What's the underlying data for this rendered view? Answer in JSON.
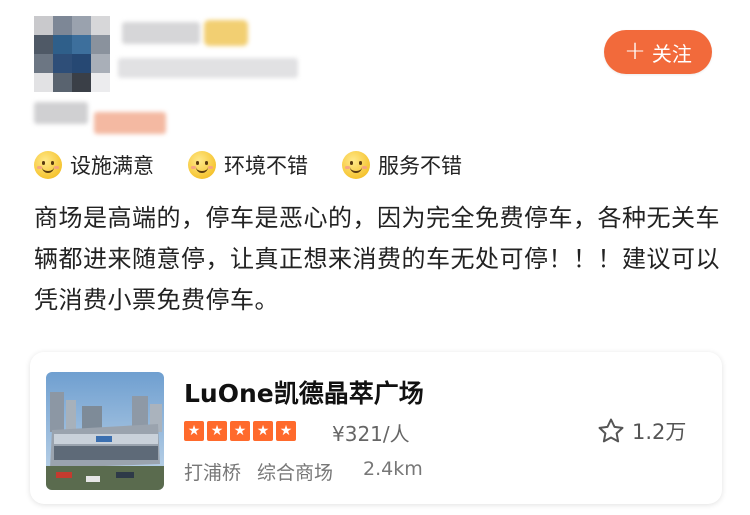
{
  "header": {
    "follow_label": "关注"
  },
  "tags": [
    {
      "label": "设施满意"
    },
    {
      "label": "环境不错"
    },
    {
      "label": "服务不错"
    }
  ],
  "review": {
    "text": "商场是高端的，停车是恶心的，因为完全免费停车，各种无关车辆都进来随意停，让真正想来消费的车无处可停！！！建议可以凭消费小票免费停车。"
  },
  "poi": {
    "name": "LuOne凯德晶萃广场",
    "rating": 5,
    "price": "¥321/人",
    "district": "打浦桥",
    "category": "综合商场",
    "distance": "2.4km",
    "favorites": "1.2万"
  },
  "colors": {
    "accent": "#f26a3b",
    "star": "#ff6a2c"
  },
  "icons": {
    "tag_icon": "smiley-icon",
    "favorite_icon": "star-outline-icon",
    "follow_icon": "plus-icon"
  }
}
